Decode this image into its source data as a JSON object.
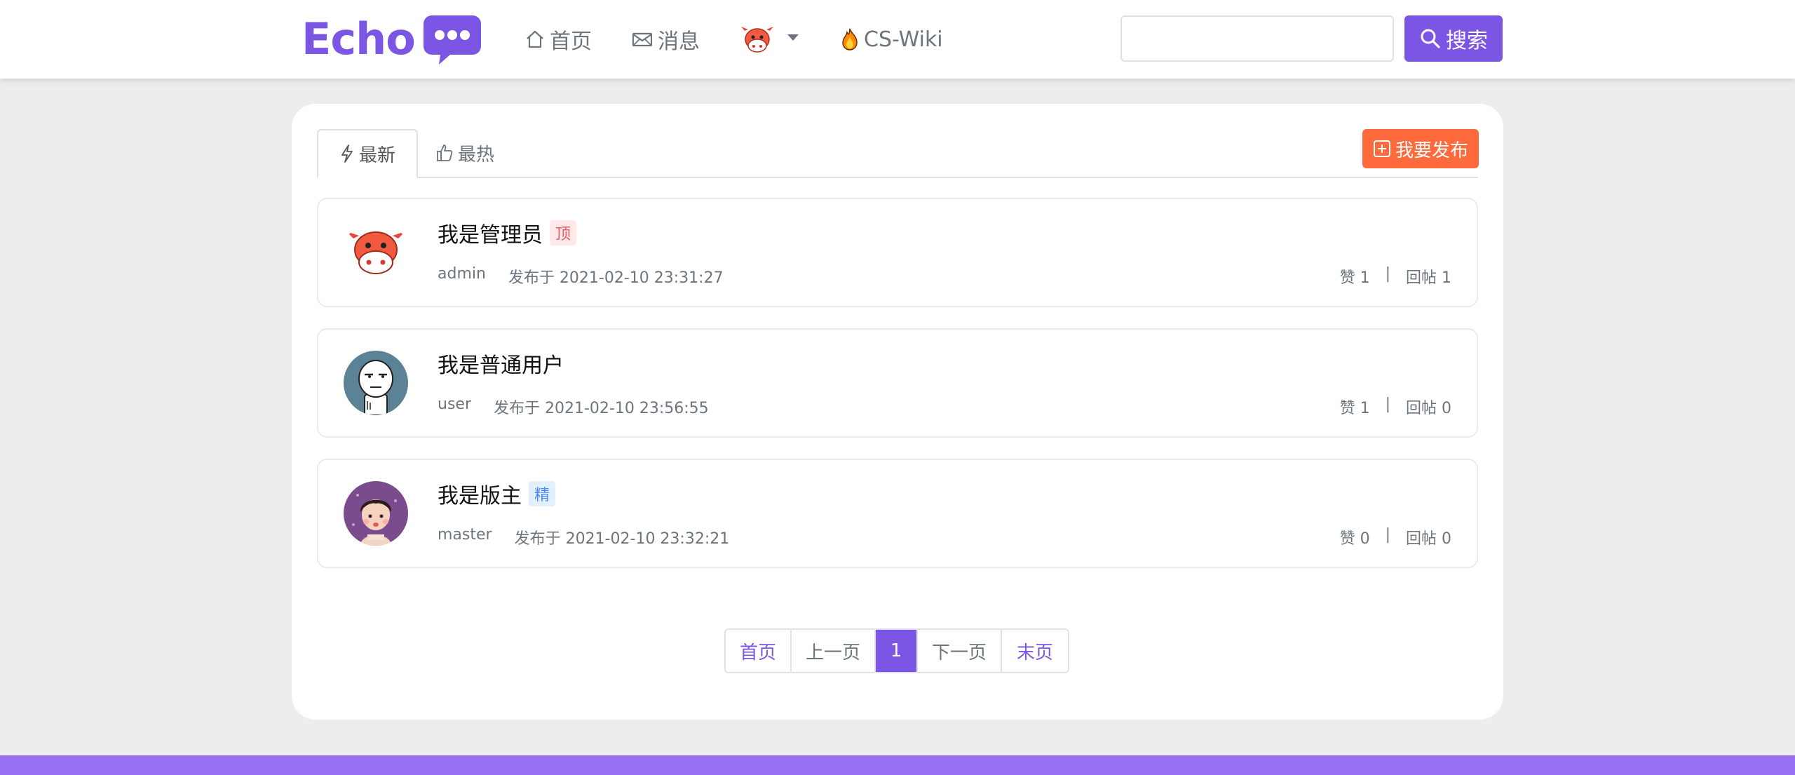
{
  "header": {
    "brand": "Echo",
    "nav": {
      "home": "首页",
      "messages": "消息",
      "wiki": "CS-Wiki"
    },
    "search": {
      "placeholder": "",
      "button": "搜索"
    }
  },
  "tabs": [
    {
      "label": "最新",
      "active": true
    },
    {
      "label": "最热",
      "active": false
    }
  ],
  "publish_button": "我要发布",
  "posts": [
    {
      "title": "我是管理员",
      "badge": "顶",
      "author": "admin",
      "time": "发布于 2021-02-10 23:31:27",
      "likes": "赞 1",
      "separator": "|",
      "replies": "回帖 1"
    },
    {
      "title": "我是普通用户",
      "badge": "",
      "author": "user",
      "time": "发布于 2021-02-10 23:56:55",
      "likes": "赞 1",
      "separator": "|",
      "replies": "回帖 0"
    },
    {
      "title": "我是版主",
      "badge": "精",
      "author": "master",
      "time": "发布于 2021-02-10 23:32:21",
      "likes": "赞 0",
      "separator": "|",
      "replies": "回帖 0"
    }
  ],
  "pagination": {
    "first": "首页",
    "prev": "上一页",
    "current": "1",
    "next": "下一页",
    "last": "末页"
  },
  "colors": {
    "brand": "#7b55e3",
    "publish": "#ff6a3d",
    "footer": "#9770f2",
    "badge_top": "#e55a66",
    "badge_good": "#4a8bf0"
  },
  "icons": {
    "home": "home-icon",
    "messages": "envelope-icon",
    "user": "cow-avatar-icon",
    "wiki": "fire-icon",
    "search": "search-icon",
    "tab_new": "lightning-icon",
    "tab_hot": "thumbs-up-icon",
    "publish": "plus-square-icon"
  }
}
